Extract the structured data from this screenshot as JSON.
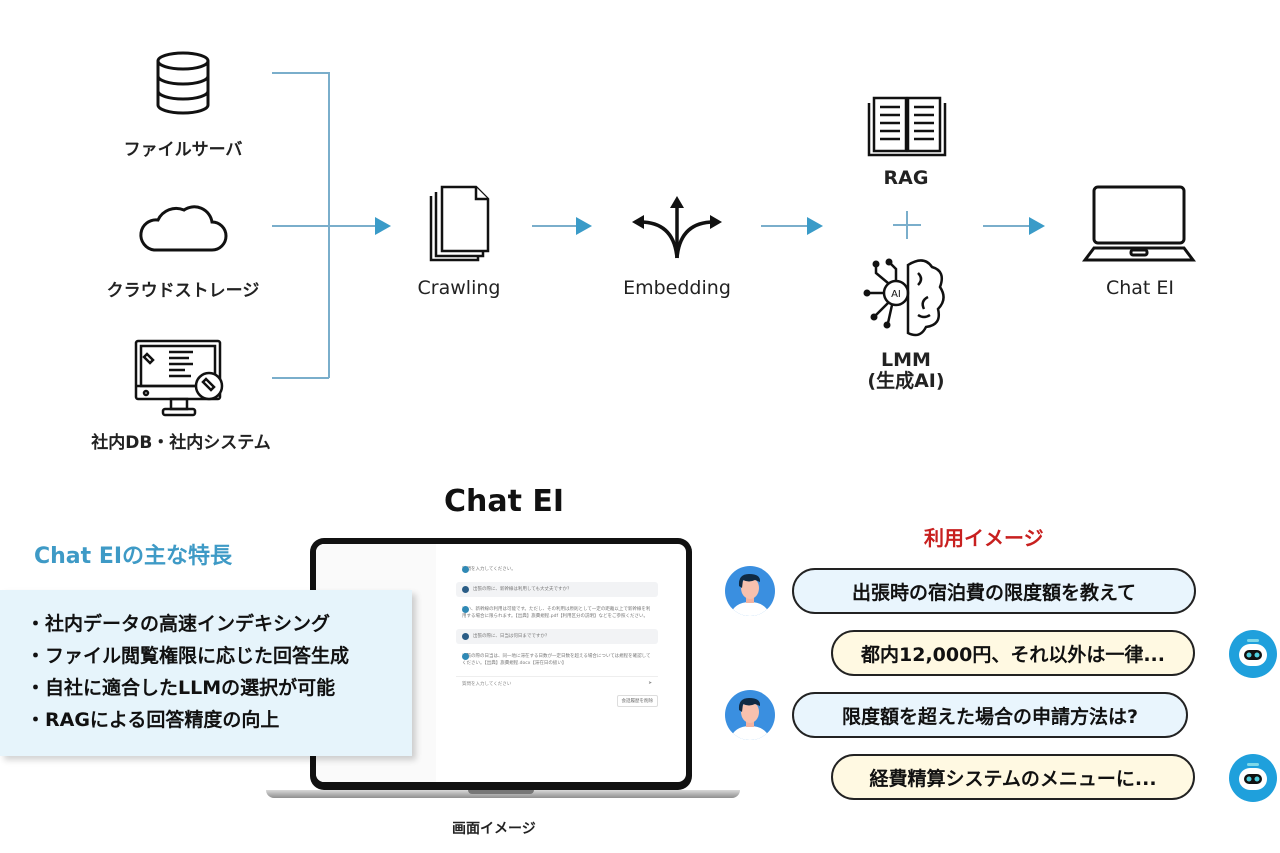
{
  "sources": [
    {
      "label": "ファイルサーバ",
      "icon": "database-icon"
    },
    {
      "label": "クラウドストレージ",
      "icon": "cloud-icon"
    },
    {
      "label": "社内DB・社内システム",
      "icon": "monitor-tools-icon"
    }
  ],
  "pipeline": {
    "crawling": {
      "label": "Crawling",
      "icon": "documents-icon"
    },
    "embedding": {
      "label": "Embedding",
      "icon": "branching-arrows-icon"
    },
    "rag": {
      "label": "RAG",
      "icon": "open-book-icon"
    },
    "plus": "+",
    "lmm": {
      "label_line1": "LMM",
      "label_line2": "(生成AI)",
      "icon": "ai-brain-icon"
    },
    "output": {
      "label": "Chat EI",
      "icon": "laptop-icon"
    }
  },
  "features": {
    "title": "Chat EIの主な特長",
    "items": [
      "・社内データの高速インデキシング",
      "・ファイル閲覧権限に応じた回答生成",
      "・自社に適合したLLMの選択が可能",
      "・RAGによる回答精度の向上"
    ]
  },
  "screen_image": {
    "title": "Chat EI",
    "caption": "画面イメージ",
    "chat": [
      {
        "role": "bot",
        "text": "質問を入力してください。"
      },
      {
        "role": "user",
        "text": "出張の際に、新幹線は利用しても大丈夫ですか？"
      },
      {
        "role": "bot",
        "text": "はい、新幹線の利用は可能です。ただし、その利用は原則として一定の距離以上で新幹線を利用する場合に限られます。【出典】旅費規程.pdf【利用区分の説明】などをご参照ください。"
      },
      {
        "role": "user",
        "text": "出張の際に、日当は何日までですか？"
      },
      {
        "role": "bot",
        "text": "出張の際の日当は、同一地に滞在する日数が一定日数を超える場合については規程を確認してください。【出典】旅費規程.docx【滞在日の扱い】"
      }
    ],
    "input_placeholder": "質問を入力してください",
    "send_icon": "send-icon",
    "button_label": "会話履歴を削除"
  },
  "usage": {
    "title": "利用イメージ",
    "messages": [
      {
        "role": "user",
        "text": "出張時の宿泊費の限度額を教えて"
      },
      {
        "role": "bot",
        "text": "都内12,000円、それ以外は一律..."
      },
      {
        "role": "user",
        "text": "限度額を超えた場合の申請方法は?"
      },
      {
        "role": "bot",
        "text": "経費精算システムのメニューに..."
      }
    ]
  },
  "colors": {
    "accent_blue": "#3e9ac6",
    "arrow_blue": "#3a9bc8",
    "usage_red": "#c8201f",
    "feature_bg": "#e6f4fb",
    "question_bubble": "#e9f5fd",
    "answer_bubble": "#fff9e2"
  }
}
